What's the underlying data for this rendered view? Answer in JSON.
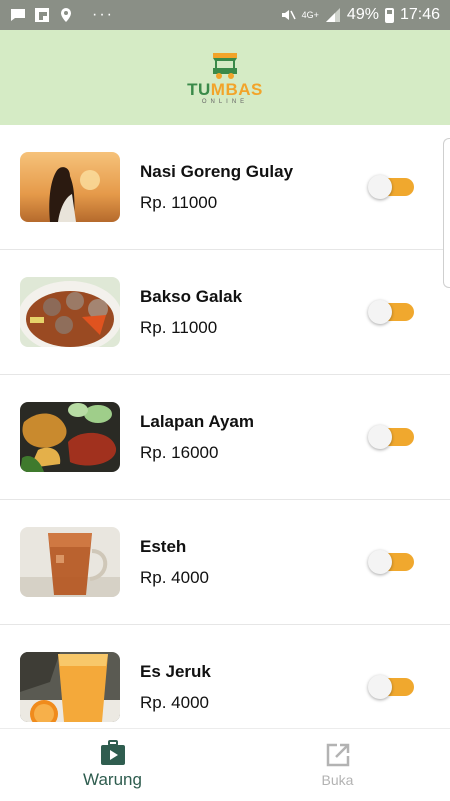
{
  "status_bar": {
    "battery": "49%",
    "time": "17:46",
    "network": "4G+",
    "more": "···"
  },
  "header": {
    "logo_main_a": "TU",
    "logo_main_b": "MBAS",
    "logo_sub": "ONLINE"
  },
  "menu_items": [
    {
      "name": "Nasi Goreng Gulay",
      "price": "Rp. 11000",
      "available": true
    },
    {
      "name": "Bakso Galak",
      "price": "Rp. 11000",
      "available": true
    },
    {
      "name": "Lalapan Ayam",
      "price": "Rp. 16000",
      "available": true
    },
    {
      "name": "Esteh",
      "price": "Rp. 4000",
      "available": true
    },
    {
      "name": "Es Jeruk",
      "price": "Rp. 4000",
      "available": true
    }
  ],
  "bottom_nav": {
    "warung_label": "Warung",
    "buka_label": "Buka"
  },
  "colors": {
    "header_bg": "#d5ebc5",
    "toggle_on": "#f0a82e",
    "nav_active": "#2f5d4f",
    "nav_inactive": "#b3b3b3"
  }
}
